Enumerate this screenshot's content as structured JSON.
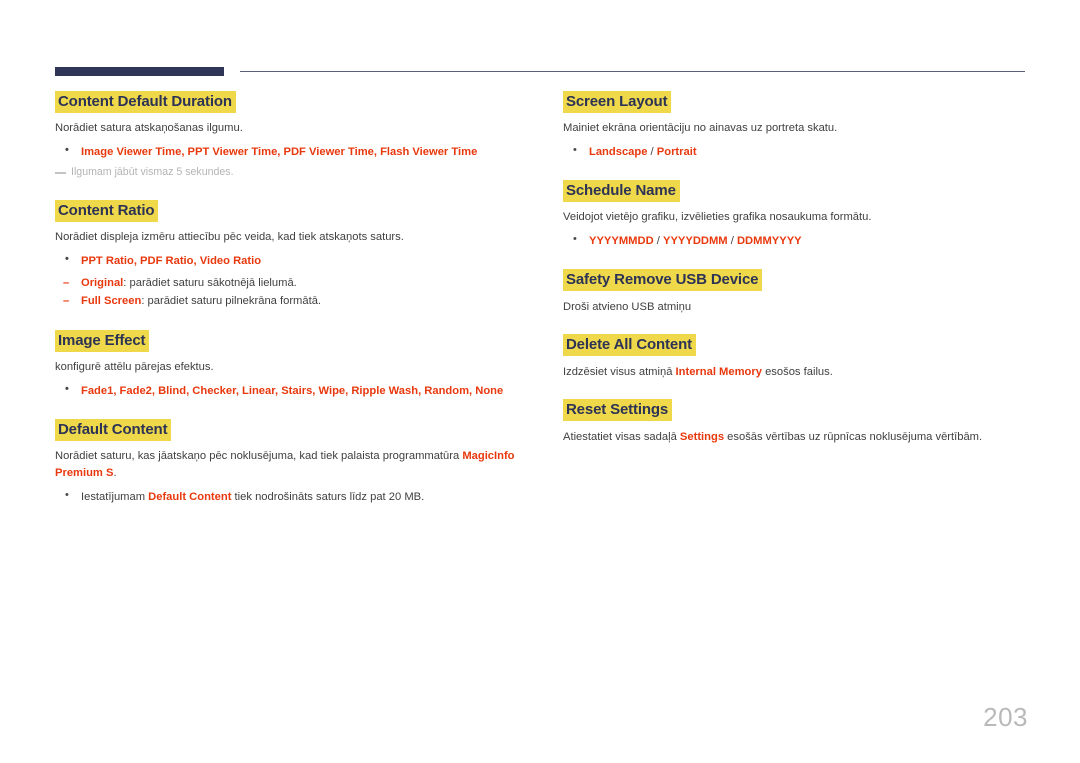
{
  "document": {
    "page_number": "203",
    "colors": {
      "heading_highlight": "#efd94a",
      "heading_text": "#2d3355",
      "accent_red": "#e8380d",
      "rule_dark": "#2e3557",
      "rule_thin": "#5b5f7d",
      "body_text": "#3f3f3f",
      "note_text": "#b4b4b4",
      "page_number": "#b9b9b9"
    }
  },
  "left_column": [
    {
      "heading": "Content Default Duration",
      "desc": "Norādiet satura atskaņošanas ilgumu.",
      "bullets": [
        {
          "text": "Image Viewer Time, PPT Viewer Time, PDF Viewer Time, Flash Viewer Time",
          "style": "red"
        }
      ],
      "note": "Ilgumam jābūt vismaz 5 sekundes."
    },
    {
      "heading": "Content Ratio",
      "desc": "Norādiet displeja izmēru attiecību pēc veida, kad tiek atskaņots saturs.",
      "bullets": [
        {
          "text": "PPT Ratio, PDF Ratio, Video Ratio",
          "style": "red"
        }
      ],
      "subbullets": [
        {
          "term": "Original",
          "rest": ": parādiet saturu sākotnējā lielumā."
        },
        {
          "term": "Full Screen",
          "rest": ": parādiet saturu pilnekrāna formātā."
        }
      ]
    },
    {
      "heading": "Image Effect",
      "desc": "konfigurē attēlu pārejas efektus.",
      "bullets": [
        {
          "text": "Fade1, Fade2, Blind, Checker, Linear, Stairs, Wipe, Ripple Wash, Random, None",
          "style": "red"
        }
      ]
    },
    {
      "heading": "Default Content",
      "desc_parts": [
        {
          "text": "Norādiet saturu, kas jāatskaņo pēc noklusējuma, kad tiek palaista programmatūra ",
          "style": "dark"
        },
        {
          "text": "MagicInfo Premium S",
          "style": "red"
        },
        {
          "text": ".",
          "style": "dark"
        }
      ],
      "bullets": [
        {
          "parts": [
            {
              "text": "Iestatījumam ",
              "style": "dark"
            },
            {
              "text": "Default Content",
              "style": "red"
            },
            {
              "text": " tiek nodrošināts saturs līdz pat 20 MB.",
              "style": "dark"
            }
          ]
        }
      ]
    }
  ],
  "right_column": [
    {
      "heading": "Screen Layout",
      "desc": "Mainiet ekrāna orientāciju no ainavas uz portreta skatu.",
      "bullets": [
        {
          "parts": [
            {
              "text": "Landscape",
              "style": "red"
            },
            {
              "text": " / ",
              "style": "dark"
            },
            {
              "text": "Portrait",
              "style": "red"
            }
          ]
        }
      ]
    },
    {
      "heading": "Schedule Name",
      "desc": "Veidojot vietējo grafiku, izvēlieties grafika nosaukuma formātu.",
      "bullets": [
        {
          "parts": [
            {
              "text": "YYYYMMDD",
              "style": "red"
            },
            {
              "text": " / ",
              "style": "dark"
            },
            {
              "text": "YYYYDDMM",
              "style": "red"
            },
            {
              "text": " / ",
              "style": "dark"
            },
            {
              "text": "DDMMYYYY",
              "style": "red"
            }
          ]
        }
      ]
    },
    {
      "heading": "Safety Remove USB Device",
      "desc": "Droši atvieno USB atmiņu"
    },
    {
      "heading": "Delete All Content",
      "desc_parts": [
        {
          "text": "Izdzēsiet visus atmiņā ",
          "style": "dark"
        },
        {
          "text": "Internal Memory",
          "style": "red"
        },
        {
          "text": " esošos failus.",
          "style": "dark"
        }
      ]
    },
    {
      "heading": "Reset Settings",
      "desc_parts": [
        {
          "text": "Atiestatiet visas sadaļā ",
          "style": "dark"
        },
        {
          "text": "Settings",
          "style": "red"
        },
        {
          "text": " esošās vērtības uz rūpnīcas noklusējuma vērtībām.",
          "style": "dark"
        }
      ]
    }
  ]
}
